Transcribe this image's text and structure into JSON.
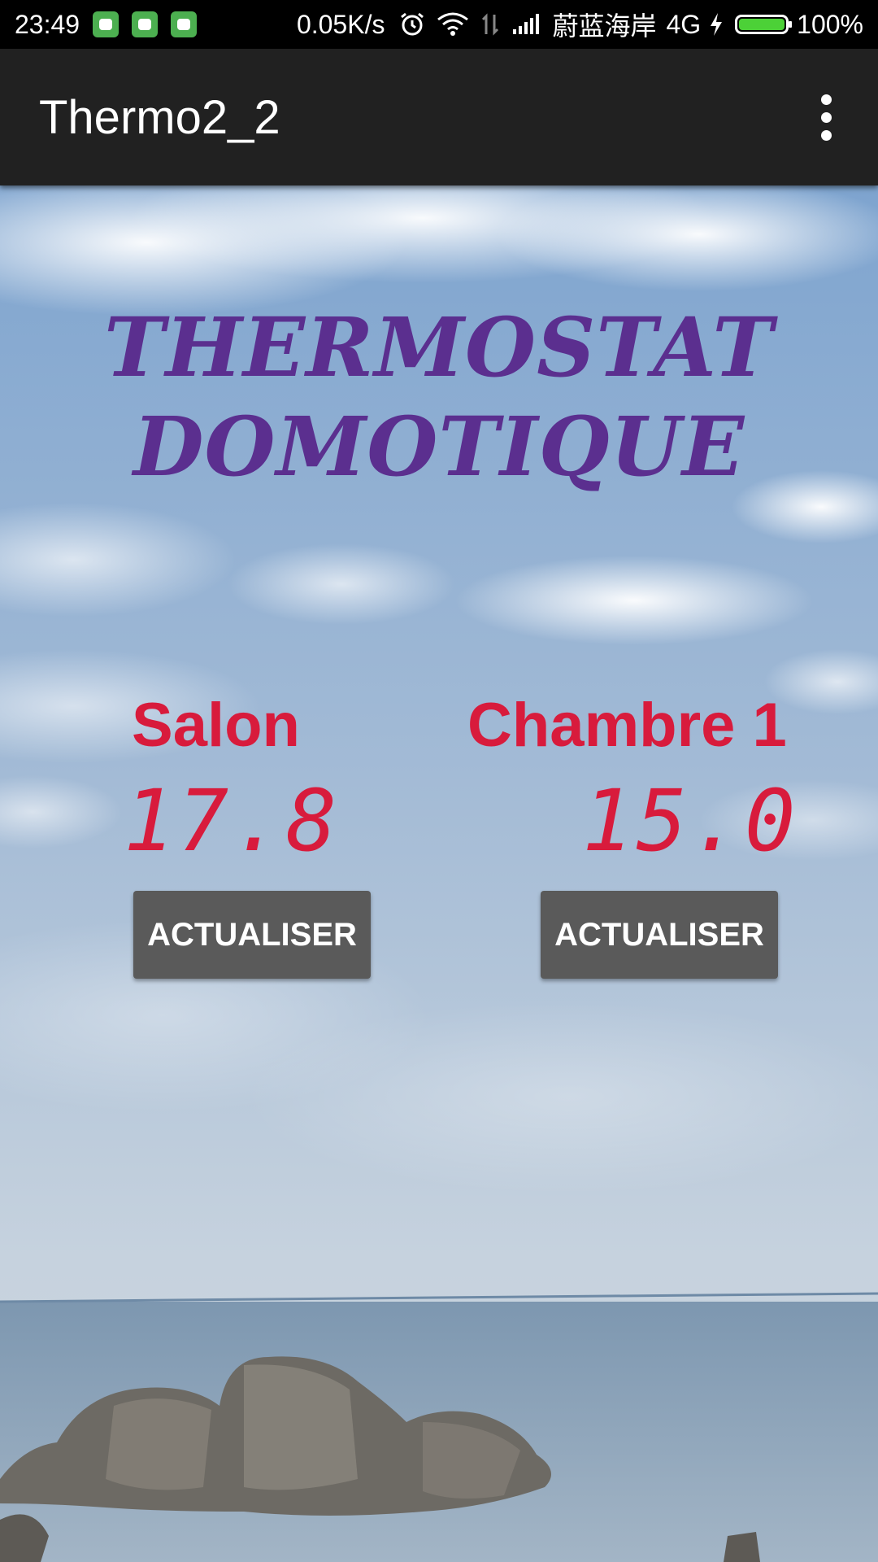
{
  "status_bar": {
    "time": "23:49",
    "app_icons": [
      "android-icon",
      "battery-app-icon",
      "android-icon"
    ],
    "network_speed": "0.05K/s",
    "carrier": "蔚蓝海岸",
    "network_type": "4G",
    "battery": "100%",
    "battery_color": "#4cd137"
  },
  "action_bar": {
    "title": "Thermo2_2",
    "menu_icon": "overflow-menu-icon",
    "background_color": "#212121"
  },
  "main": {
    "heading_line1": "THERMOSTAT",
    "heading_line2": "DOMOTIQUE",
    "heading_color": "#5b2f8f",
    "rooms": [
      {
        "name": "Salon",
        "temperature": "17.8",
        "button_label": "ACTUALISER"
      },
      {
        "name": "Chambre 1",
        "temperature": "15.0",
        "button_label": "ACTUALISER"
      }
    ],
    "accent_color": "#d81b3c",
    "button_color": "#5a5a5a"
  }
}
